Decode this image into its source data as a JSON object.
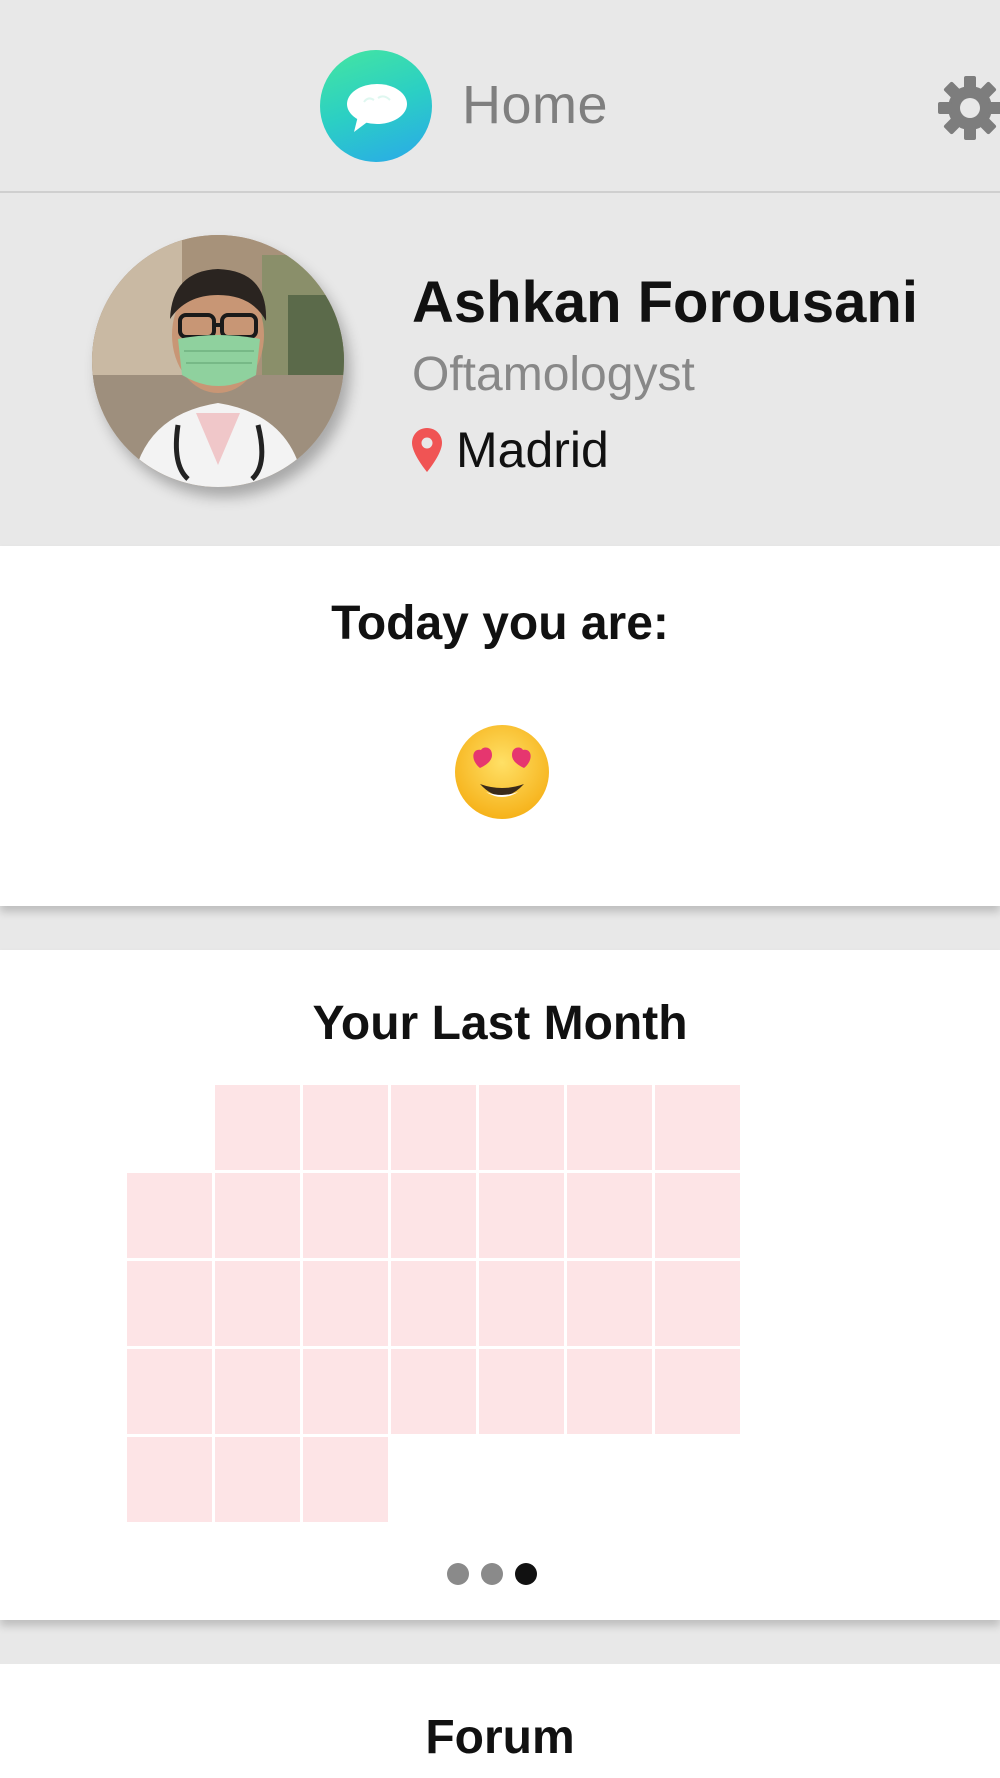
{
  "header": {
    "title": "Home"
  },
  "profile": {
    "name": "Ashkan Forousani",
    "role": "Oftamologyst",
    "location": "Madrid"
  },
  "today": {
    "title": "Today you are:",
    "mood": "😍"
  },
  "last_month": {
    "title": "Your Last Month",
    "weeks": [
      [
        "",
        "x",
        "x",
        "x",
        "x",
        "x",
        "x"
      ],
      [
        "x",
        "x",
        "x",
        "x",
        "x",
        "x",
        "x"
      ],
      [
        "x",
        "x",
        "x",
        "x",
        "x",
        "x",
        "x"
      ],
      [
        "x",
        "x",
        "x",
        "x",
        "x",
        "x",
        "x"
      ],
      [
        "x",
        "x",
        "x",
        "",
        "",
        "",
        ""
      ]
    ],
    "pager": {
      "count": 3,
      "active": 3
    }
  },
  "forum": {
    "title": "Forum"
  },
  "colors": {
    "accent_start": "#45e6a0",
    "accent_end": "#2aa8ea",
    "calendar_cell": "#fde4e6",
    "pin": "#f05454"
  }
}
